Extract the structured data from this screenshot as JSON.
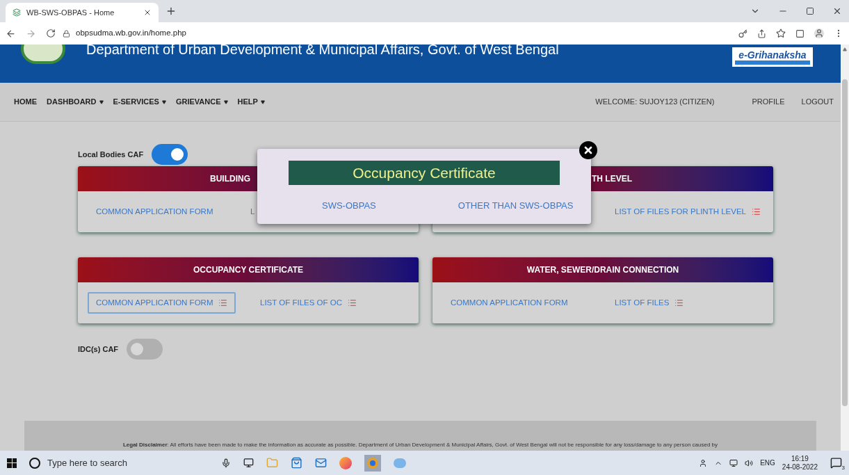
{
  "browser": {
    "tab_title": "WB-SWS-OBPAS - Home",
    "url": "obpsudma.wb.gov.in/home.php"
  },
  "header": {
    "title": "Department of Urban Development & Municipal Affairs, Govt. of West Bengal",
    "logo_text": "e-Grihanaksha"
  },
  "nav": {
    "items": [
      {
        "label": "HOME",
        "dropdown": false
      },
      {
        "label": "DASHBOARD",
        "dropdown": true
      },
      {
        "label": "E-SERVICES",
        "dropdown": true
      },
      {
        "label": "GRIEVANCE",
        "dropdown": true
      },
      {
        "label": "HELP",
        "dropdown": true
      }
    ],
    "welcome": "WELCOME: SUJOY123 (CITIZEN)",
    "links": [
      "PROFILE",
      "LOGOUT"
    ]
  },
  "sections": [
    {
      "label": "Local Bodies CAF",
      "on": true,
      "cards": [
        {
          "title": "BUILDING",
          "links": [
            {
              "label": "COMMON APPLICATION FORM",
              "kind": "form",
              "icon": false,
              "focused": false
            },
            {
              "label": "L",
              "kind": "list",
              "icon": false,
              "focused": false
            }
          ]
        },
        {
          "title": "TH LEVEL",
          "links": [
            {
              "label": "LIST OF FILES FOR PLINTH LEVEL",
              "kind": "list",
              "icon": true,
              "focused": false
            }
          ]
        },
        {
          "title": "OCCUPANCY CERTIFICATE",
          "links": [
            {
              "label": "COMMON APPLICATION FORM",
              "kind": "form",
              "icon": true,
              "focused": true
            },
            {
              "label": "LIST OF FILES OF OC",
              "kind": "list",
              "icon": true,
              "focused": false
            }
          ]
        },
        {
          "title": "WATER, SEWER/DRAIN CONNECTION",
          "links": [
            {
              "label": "COMMON APPLICATION FORM",
              "kind": "form",
              "icon": false,
              "focused": false
            },
            {
              "label": "LIST OF FILES",
              "kind": "list",
              "icon": true,
              "focused": false
            }
          ]
        }
      ]
    },
    {
      "label": "IDC(s) CAF",
      "on": false
    }
  ],
  "modal": {
    "title": "Occupancy Certificate",
    "options": [
      "SWS-OBPAS",
      "OTHER THAN SWS-OBPAS"
    ]
  },
  "footer": {
    "disclaimer": "**Legal Disclaimer**: All efforts have been made to make the information as accurate as possible. Department of Urban Development & Municipal Affairs, Govt. of West Bengal will not be responsible for any loss/damage to any person caused by"
  },
  "taskbar": {
    "search_placeholder": "Type here to search",
    "language": "ENG",
    "time": "16:19",
    "date": "24-08-2022",
    "notifications": "3"
  }
}
